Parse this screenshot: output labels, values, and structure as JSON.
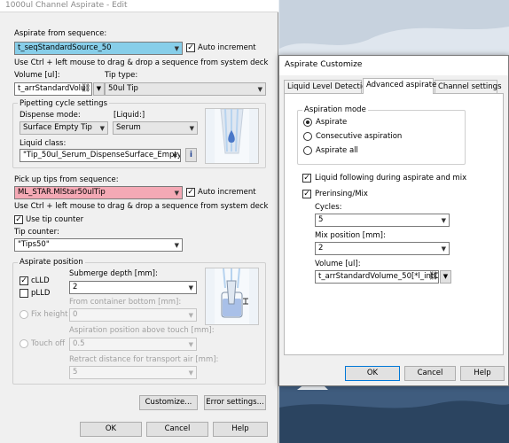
{
  "main": {
    "title": "1000ul Channel Aspirate - Edit",
    "aspirate_from_sequence_label": "Aspirate from sequence:",
    "aspirate_sequence_value": "t_seqStandardSource_50",
    "auto_increment_label": "Auto increment",
    "drag_hint": "Use Ctrl + left mouse to drag & drop a sequence from system deck",
    "volume_label": "Volume [ul]:",
    "volume_value": "t_arrStandardVolu",
    "tip_type_label": "Tip type:",
    "tip_type_value": "50ul Tip",
    "pipetting_group_label": "Pipetting cycle settings",
    "dispense_mode_label": "Dispense mode:",
    "dispense_mode_value": "Surface Empty Tip",
    "liquid_label": "[Liquid:]",
    "liquid_value": "Serum",
    "liquid_class_label": "Liquid class:",
    "liquid_class_value": "\"Tip_50ul_Serum_DispenseSurface_Empty\"",
    "info_button": "i",
    "pickup_label": "Pick up tips from sequence:",
    "pickup_value": "ML_STAR.MlStar50ulTip",
    "auto_increment_label_2": "Auto increment",
    "drag_hint_2": "Use Ctrl + left mouse to drag & drop a sequence from system deck",
    "use_tip_counter_label": "Use tip counter",
    "tip_counter_label": "Tip counter:",
    "tip_counter_value": "\"Tips50\"",
    "aspirate_position_label": "Aspirate position",
    "clld_label": "cLLD",
    "plld_label": "pLLD",
    "submerge_label": "Submerge depth [mm]:",
    "submerge_value": "2",
    "fix_height_label": "Fix height",
    "from_bottom_label": "From container bottom [mm]:",
    "from_bottom_value": "0",
    "touch_off_label": "Touch off",
    "above_touch_label": "Aspiration position above touch [mm]:",
    "above_touch_value": "0.5",
    "retract_label": "Retract distance for transport air [mm]:",
    "retract_value": "5",
    "customize_button": "Customize...",
    "error_settings_button": "Error settings...",
    "ok_button": "OK",
    "cancel_button": "Cancel",
    "help_button": "Help"
  },
  "dialog": {
    "title": "Aspirate Customize",
    "tabs": [
      "Liquid Level Detection",
      "Advanced aspirate",
      "Channel settings"
    ],
    "aspiration_mode_label": "Aspiration mode",
    "mode_aspirate": "Aspirate",
    "mode_consecutive": "Consecutive aspiration",
    "mode_aspirate_all": "Aspirate all",
    "liquid_following_label": "Liquid following during aspirate and mix",
    "prerinsing_label": "Prerinsing/Mix",
    "cycles_label": "Cycles:",
    "cycles_value": "5",
    "mix_position_label": "Mix position [mm]:",
    "mix_position_value": "2",
    "volume_label": "Volume [ul]:",
    "volume_value": "t_arrStandardVolume_50[*l_intC",
    "ok_button": "OK",
    "cancel_button": "Cancel",
    "help_button": "Help"
  },
  "colors": {
    "sequence_highlight": "#87cee9",
    "tips_highlight": "#f4a9b5",
    "liquid_blue": "#4a78c8"
  }
}
